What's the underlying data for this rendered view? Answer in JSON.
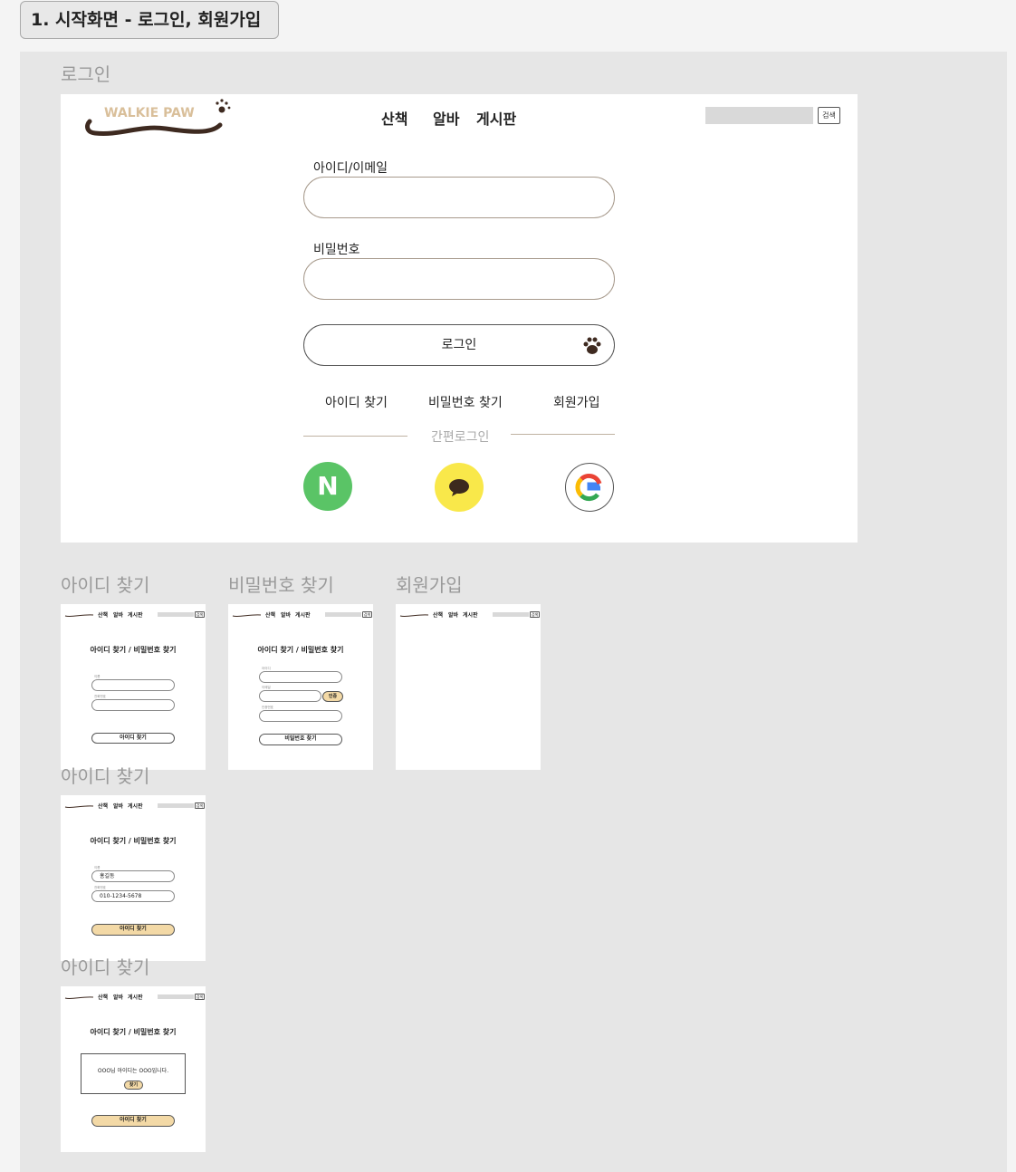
{
  "section": {
    "title": "1. 시작화면 - 로그인, 회원가입"
  },
  "frames": {
    "login": "로그인",
    "find_id": "아이디 찾기",
    "find_pw": "비밀번호 찾기",
    "signup": "회원가입",
    "find_id_filled": "아이디 찾기",
    "find_id_result": "아이디 찾기"
  },
  "header": {
    "logo_text": "WALKIE PAW",
    "nav": [
      "산책",
      "알바",
      "게시판"
    ],
    "search_button": "검색"
  },
  "login_form": {
    "id_label": "아이디/이메일",
    "id_value": "",
    "pw_label": "비밀번호",
    "pw_value": "",
    "login_button": "로그인",
    "links": [
      "아이디 찾기",
      "비밀번호 찾기",
      "회원가입"
    ],
    "easy_login": "간편로그인",
    "social": [
      {
        "name": "naver",
        "glyph": "N",
        "color": "#5ac466"
      },
      {
        "name": "kakao",
        "glyph": "●",
        "color": "#f9e84a"
      },
      {
        "name": "google",
        "glyph": "G",
        "color": "#ffffff"
      }
    ]
  },
  "mini": {
    "heading": "아이디 찾기 / 비밀번호 찾기",
    "find_id": {
      "label1": "이름",
      "label2": "전화번호",
      "button": "아이디 찾기"
    },
    "find_pw": {
      "label1": "아이디",
      "label2": "이메일",
      "label3": "인증번호",
      "verify_button": "인증",
      "button": "비밀번호 찾기"
    },
    "find_id_filled": {
      "name": "홍길동",
      "phone": "010-1234-5678",
      "button": "아이디 찾기"
    },
    "find_id_result": {
      "message": "OOO님 아이디는 OOO입니다.",
      "ok": "찾기",
      "button": "아이디 찾기"
    }
  }
}
